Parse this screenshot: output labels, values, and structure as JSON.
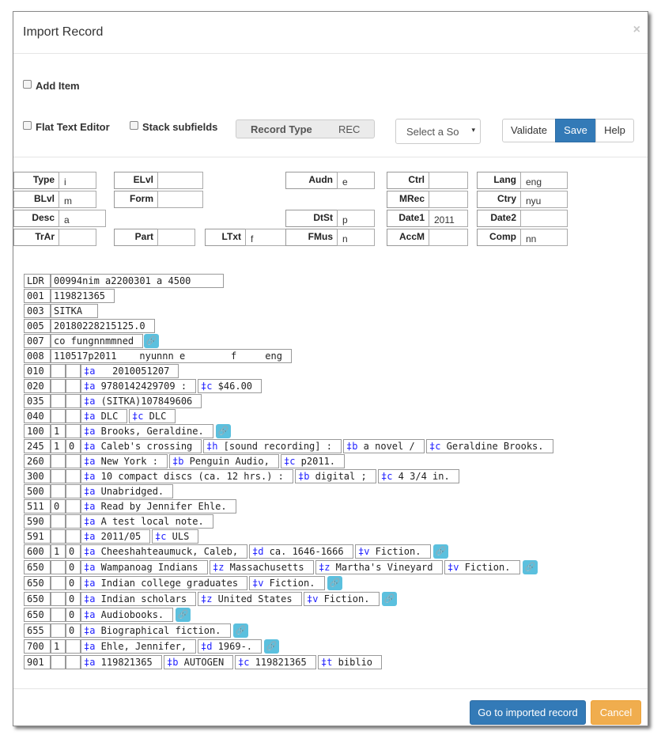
{
  "modal": {
    "title": "Import Record",
    "close": "×"
  },
  "options": {
    "add_item": "Add Item",
    "flat_text_editor": "Flat Text Editor",
    "stack_subfields": "Stack subfields"
  },
  "record_type": {
    "label": "Record Type",
    "value": "REC"
  },
  "source_select": {
    "value": "Select a So",
    "arrow": "▾"
  },
  "toolbar": {
    "validate": "Validate",
    "save": "Save",
    "help": "Help"
  },
  "fixed_fields": [
    {
      "label": "Type",
      "value": "i"
    },
    {
      "label": "ELvl",
      "value": ""
    },
    {
      "label": "Audn",
      "value": "e"
    },
    {
      "label": "Ctrl",
      "value": ""
    },
    {
      "label": "Lang",
      "value": "eng"
    },
    {
      "label": "BLvl",
      "value": "m"
    },
    {
      "label": "Form",
      "value": ""
    },
    {
      "label": "MRec",
      "value": ""
    },
    {
      "label": "Ctry",
      "value": "nyu"
    },
    {
      "label": "Desc",
      "value": "a"
    },
    {
      "label": "DtSt",
      "value": "p"
    },
    {
      "label": "Date1",
      "value": "2011"
    },
    {
      "label": "Date2",
      "value": ""
    },
    {
      "label": "TrAr",
      "value": ""
    },
    {
      "label": "Part",
      "value": ""
    },
    {
      "label": "LTxt",
      "value": "f"
    },
    {
      "label": "FMus",
      "value": "n"
    },
    {
      "label": "AccM",
      "value": ""
    },
    {
      "label": "Comp",
      "value": "nn"
    }
  ],
  "marc": {
    "ldr": {
      "tag": "LDR",
      "value": "00994nim a2200301 a 4500"
    },
    "control": [
      {
        "tag": "001",
        "value": "119821365"
      },
      {
        "tag": "003",
        "value": "SITKA"
      },
      {
        "tag": "005",
        "value": "20180228215125.0"
      },
      {
        "tag": "007",
        "value": "co fungnnmmned"
      },
      {
        "tag": "008",
        "value": "110517p2011    nyunnn e        f     eng"
      }
    ],
    "fields": [
      {
        "tag": "010",
        "i1": "",
        "i2": "",
        "subfields": [
          {
            "code": "‡a",
            "value": "  2010051207"
          }
        ]
      },
      {
        "tag": "020",
        "i1": "",
        "i2": "",
        "subfields": [
          {
            "code": "‡a",
            "value": "9780142429709 :"
          },
          {
            "code": "‡c",
            "value": "$46.00"
          }
        ]
      },
      {
        "tag": "035",
        "i1": "",
        "i2": "",
        "subfields": [
          {
            "code": "‡a",
            "value": "(SITKA)107849606"
          }
        ]
      },
      {
        "tag": "040",
        "i1": "",
        "i2": "",
        "subfields": [
          {
            "code": "‡a",
            "value": "DLC"
          },
          {
            "code": "‡c",
            "value": "DLC"
          }
        ]
      },
      {
        "tag": "100",
        "i1": "1",
        "i2": "",
        "subfields": [
          {
            "code": "‡a",
            "value": "Brooks, Geraldine."
          }
        ]
      },
      {
        "tag": "245",
        "i1": "1",
        "i2": "0",
        "subfields": [
          {
            "code": "‡a",
            "value": "Caleb's crossing"
          },
          {
            "code": "‡h",
            "value": "[sound recording] :"
          },
          {
            "code": "‡b",
            "value": "a novel /"
          },
          {
            "code": "‡c",
            "value": "Geraldine Brooks."
          }
        ]
      },
      {
        "tag": "260",
        "i1": "",
        "i2": "",
        "subfields": [
          {
            "code": "‡a",
            "value": "New York :"
          },
          {
            "code": "‡b",
            "value": "Penguin Audio,"
          },
          {
            "code": "‡c",
            "value": "p2011."
          }
        ]
      },
      {
        "tag": "300",
        "i1": "",
        "i2": "",
        "subfields": [
          {
            "code": "‡a",
            "value": "10 compact discs (ca. 12 hrs.) :"
          },
          {
            "code": "‡b",
            "value": "digital ;"
          },
          {
            "code": "‡c",
            "value": "4 3/4 in."
          }
        ]
      },
      {
        "tag": "500",
        "i1": "",
        "i2": "",
        "subfields": [
          {
            "code": "‡a",
            "value": "Unabridged."
          }
        ]
      },
      {
        "tag": "511",
        "i1": "0",
        "i2": "",
        "subfields": [
          {
            "code": "‡a",
            "value": "Read by Jennifer Ehle."
          }
        ]
      },
      {
        "tag": "590",
        "i1": "",
        "i2": "",
        "subfields": [
          {
            "code": "‡a",
            "value": "A test local note."
          }
        ]
      },
      {
        "tag": "591",
        "i1": "",
        "i2": "",
        "subfields": [
          {
            "code": "‡a",
            "value": "2011/05"
          },
          {
            "code": "‡c",
            "value": "ULS"
          }
        ]
      },
      {
        "tag": "600",
        "i1": "1",
        "i2": "0",
        "subfields": [
          {
            "code": "‡a",
            "value": "Cheeshahteaumuck, Caleb,"
          },
          {
            "code": "‡d",
            "value": "ca. 1646-1666"
          },
          {
            "code": "‡v",
            "value": "Fiction."
          }
        ]
      },
      {
        "tag": "650",
        "i1": "",
        "i2": "0",
        "subfields": [
          {
            "code": "‡a",
            "value": "Wampanoag Indians"
          },
          {
            "code": "‡z",
            "value": "Massachusetts"
          },
          {
            "code": "‡z",
            "value": "Martha's Vineyard"
          },
          {
            "code": "‡v",
            "value": "Fiction."
          }
        ]
      },
      {
        "tag": "650",
        "i1": "",
        "i2": "0",
        "subfields": [
          {
            "code": "‡a",
            "value": "Indian college graduates"
          },
          {
            "code": "‡v",
            "value": "Fiction."
          }
        ]
      },
      {
        "tag": "650",
        "i1": "",
        "i2": "0",
        "subfields": [
          {
            "code": "‡a",
            "value": "Indian scholars"
          },
          {
            "code": "‡z",
            "value": "United States"
          },
          {
            "code": "‡v",
            "value": "Fiction."
          }
        ]
      },
      {
        "tag": "650",
        "i1": "",
        "i2": "0",
        "subfields": [
          {
            "code": "‡a",
            "value": "Audiobooks."
          }
        ]
      },
      {
        "tag": "655",
        "i1": "",
        "i2": "0",
        "subfields": [
          {
            "code": "‡a",
            "value": "Biographical fiction."
          }
        ]
      },
      {
        "tag": "700",
        "i1": "1",
        "i2": "",
        "subfields": [
          {
            "code": "‡a",
            "value": "Ehle, Jennifer,"
          },
          {
            "code": "‡d",
            "value": "1969-."
          }
        ]
      },
      {
        "tag": "901",
        "i1": "",
        "i2": "",
        "subfields": [
          {
            "code": "‡a",
            "value": "119821365"
          },
          {
            "code": "‡b",
            "value": "AUTOGEN"
          },
          {
            "code": "‡c",
            "value": "119821365"
          },
          {
            "code": "‡t",
            "value": "biblio"
          }
        ]
      }
    ]
  },
  "link_icon": "link-icon",
  "footer": {
    "go_to_record": "Go to imported record",
    "cancel": "Cancel"
  }
}
